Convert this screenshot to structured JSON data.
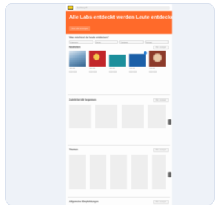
{
  "header": {
    "search_placeholder": "Suchbegriff",
    "hero_title": "Alle Labs entdeckt werden Leute entdecken",
    "hero_button": "Jetzt alle anzeigen"
  },
  "filters": {
    "title": "Was möchtest du heute entdecken?",
    "options": [
      "Kategorie",
      "Genre",
      "Sortieren",
      "Format"
    ]
  },
  "sections": {
    "new": {
      "title": "Neuheiten",
      "link": "Alle anzeigen"
    },
    "continue": {
      "title": "Zuletzt bei dir begonnen",
      "link": "Alle anzeigen"
    },
    "themes": {
      "title": "Themen",
      "link": "Alle anzeigen"
    },
    "recommended": {
      "title": "Allgemeine Empfehlungen",
      "link": "Alle anzeigen"
    }
  },
  "new_items": [
    {
      "caption": "Titel eins",
      "color": "#4a7fb0"
    },
    {
      "caption": "Titel zwei",
      "color": "#c2262a"
    },
    {
      "caption": "Titel drei",
      "color": "#2a9aa6"
    },
    {
      "caption": "Titel vier",
      "color": "#1b5fa8"
    },
    {
      "caption": "Titel fünf",
      "color": "#8c3a2a"
    }
  ]
}
